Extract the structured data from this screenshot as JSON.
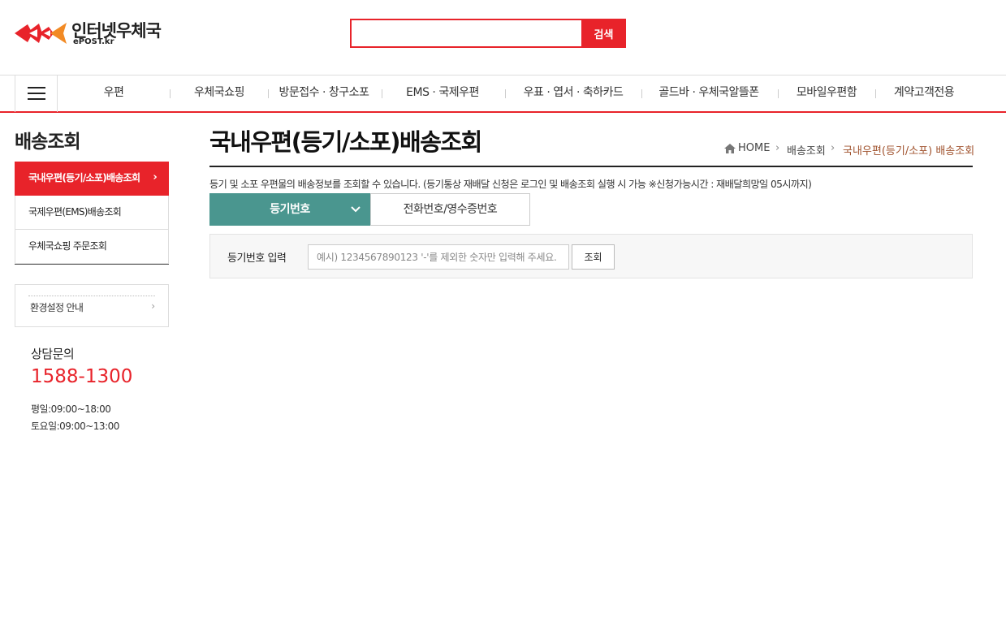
{
  "header": {
    "logo_title": "인터넷우체국",
    "logo_sub": "ePOST.kr",
    "search_placeholder": "",
    "search_button": "검색",
    "brand_color": "#e8232a"
  },
  "gnb": {
    "menu_icon": "hamburger-icon",
    "items": [
      "우편",
      "우체국쇼핑",
      "방문접수 · 창구소포",
      "EMS · 국제우편",
      "우표 · 엽서 · 축하카드",
      "골드바 · 우체국알뜰폰",
      "모바일우편함",
      "계약고객전용"
    ]
  },
  "sidebar": {
    "title": "배송조회",
    "items": [
      {
        "label": "국내우편(등기/소포)배송조회",
        "active": true
      },
      {
        "label": "국제우편(EMS)배송조회",
        "active": false
      },
      {
        "label": "우체국쇼핑 주문조회",
        "active": false
      }
    ],
    "env_label": "환경설정 안내",
    "contact_title": "상담문의",
    "contact_phone": "1588-1300",
    "hours_weekday": "평일:09:00~18:00",
    "hours_saturday": "토요일:09:00~13:00"
  },
  "main": {
    "title": "국내우편(등기/소포)배송조회",
    "breadcrumb": {
      "home": "HOME",
      "level1": "배송조회",
      "current": "국내우편(등기/소포) 배송조회"
    },
    "description": "등기 및 소포 우편물의 배송정보를 조회할 수 있습니다. (등기통상 재배달 신청은 로그인 및 배송조회 실행 시 가능 ※신청가능시간 : 재배달희망일 05시까지)",
    "tabs": [
      {
        "label": "등기번호",
        "active": true
      },
      {
        "label": "전화번호/영수증번호",
        "active": false
      }
    ],
    "form": {
      "label": "등기번호 입력",
      "placeholder": "예시) 1234567890123 '-'를 제외한 숫자만 입력해 주세요.",
      "value": "",
      "button": "조회"
    },
    "tab_color": "#4a968f"
  }
}
